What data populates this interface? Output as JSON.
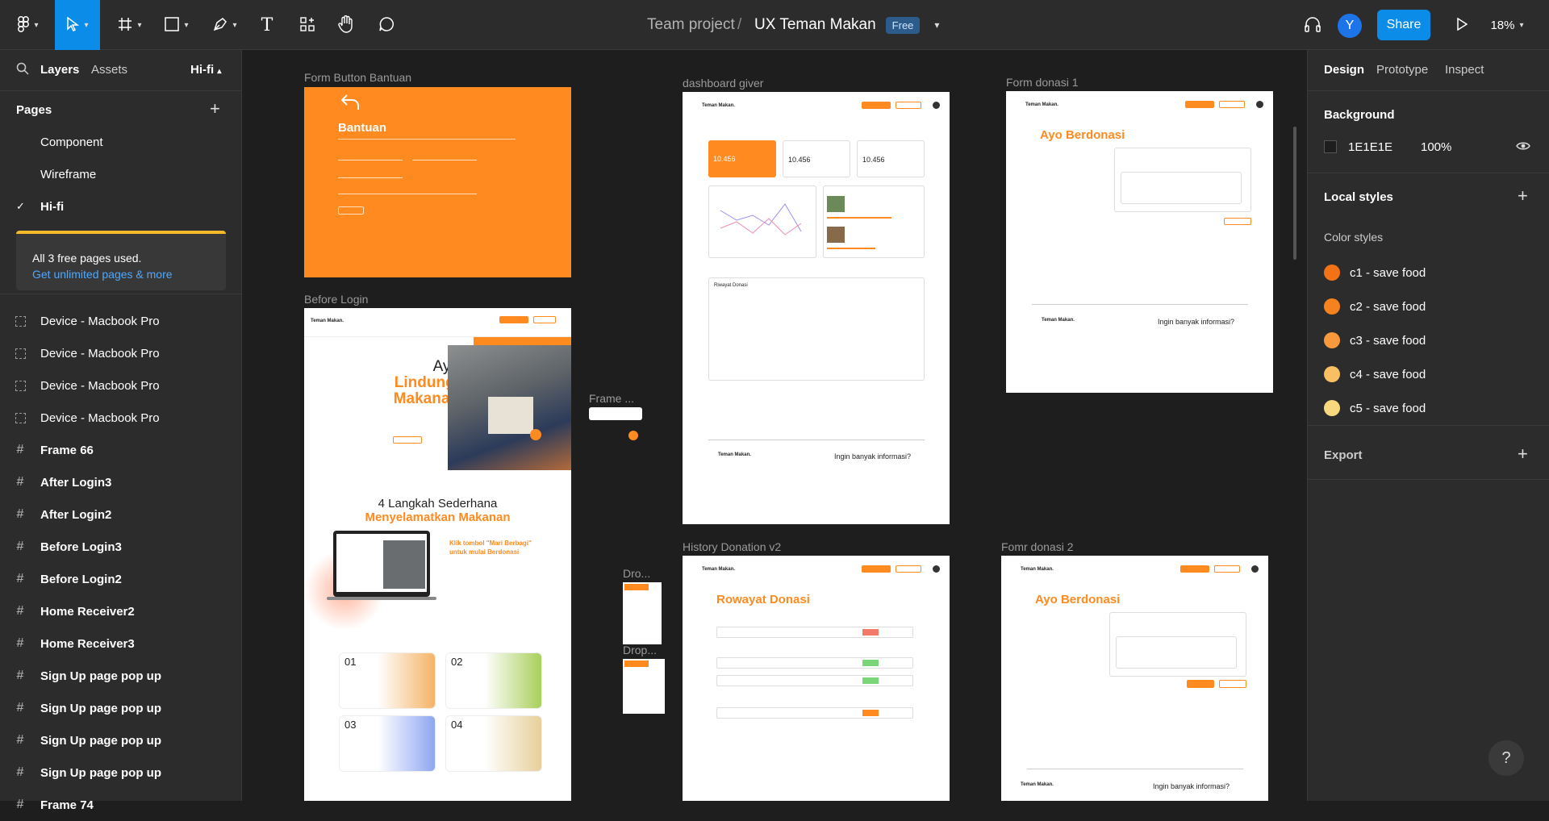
{
  "toolbar": {
    "breadcrumb_team": "Team project",
    "separator": "/",
    "file_name": "UX Teman Makan",
    "plan_badge": "Free",
    "avatar_initial": "Y",
    "share_label": "Share",
    "zoom": "18%"
  },
  "left_panel": {
    "tab_layers": "Layers",
    "tab_assets": "Assets",
    "page_selector": "Hi-fi",
    "pages_header": "Pages",
    "pages": [
      "Component",
      "Wireframe",
      "Hi-fi"
    ],
    "current_page_check": "✓",
    "notice_line1": "All 3 free pages used.",
    "notice_link": "Get unlimited pages & more",
    "layers": [
      {
        "label": "Device - Macbook Pro",
        "type": "device"
      },
      {
        "label": "Device - Macbook Pro",
        "type": "device"
      },
      {
        "label": "Device - Macbook Pro",
        "type": "device"
      },
      {
        "label": "Device - Macbook Pro",
        "type": "device"
      },
      {
        "label": "Frame 66",
        "type": "frame"
      },
      {
        "label": "After Login3",
        "type": "frame"
      },
      {
        "label": "After Login2",
        "type": "frame"
      },
      {
        "label": "Before Login3",
        "type": "frame"
      },
      {
        "label": "Before Login2",
        "type": "frame"
      },
      {
        "label": "Home Receiver2",
        "type": "frame"
      },
      {
        "label": "Home Receiver3",
        "type": "frame"
      },
      {
        "label": "Sign Up page pop up",
        "type": "frame"
      },
      {
        "label": "Sign Up page pop up",
        "type": "frame"
      },
      {
        "label": "Sign Up page pop up",
        "type": "frame"
      },
      {
        "label": "Sign Up page pop up",
        "type": "frame"
      },
      {
        "label": "Frame 74",
        "type": "frame"
      }
    ]
  },
  "canvas": {
    "frames": {
      "form_button_bantuan": {
        "label": "Form Button Bantuan",
        "title": "Bantuan"
      },
      "before_login": {
        "label": "Before Login",
        "brand": "Teman Makan.",
        "hero_line1": "Ayo",
        "hero_line2": "Lindungi",
        "hero_line3": "Makanan",
        "steps_title": "4 Langkah Sederhana",
        "steps_subtitle": "Menyelamatkan Makanan",
        "cta": "Klik tombol \"Mari Berbagi\" untuk mulai Berdonasi",
        "card_numbers": [
          "01",
          "02",
          "03",
          "04"
        ]
      },
      "dashboard_giver": {
        "label": "dashboard giver",
        "brand": "Teman Makan.",
        "stats": [
          "10.456",
          "10.456",
          "10.456"
        ],
        "riwayat": "Riwayat Donasi",
        "footer_brand": "Teman Makan.",
        "footer_title": "Ingin banyak informasi?"
      },
      "form_donasi_1": {
        "label": "Form donasi 1",
        "brand": "Teman Makan.",
        "title": "Ayo Berdonasi",
        "footer_brand": "Teman Makan.",
        "footer_title": "Ingin banyak informasi?"
      },
      "frame_small": {
        "label": "Frame ..."
      },
      "drop1": {
        "label": "Dro..."
      },
      "drop2": {
        "label": "Drop..."
      },
      "history_donation": {
        "label": "History Donation v2",
        "brand": "Teman Makan.",
        "title": "Rowayat Donasi"
      },
      "form_donasi_2": {
        "label": "Fomr donasi 2",
        "brand": "Teman Makan.",
        "title": "Ayo Berdonasi",
        "footer_brand": "Teman Makan.",
        "footer_title": "Ingin banyak informasi?"
      }
    }
  },
  "right_panel": {
    "tab_design": "Design",
    "tab_prototype": "Prototype",
    "tab_inspect": "Inspect",
    "background_header": "Background",
    "background_hex": "1E1E1E",
    "background_opacity": "100%",
    "local_styles_header": "Local styles",
    "color_styles_header": "Color styles",
    "color_styles": [
      {
        "name": "c1 - save food",
        "color": "#F47216"
      },
      {
        "name": "c2 - save food",
        "color": "#F6821F"
      },
      {
        "name": "c3 - save food",
        "color": "#F89A3C"
      },
      {
        "name": "c4 - save food",
        "color": "#F9C063"
      },
      {
        "name": "c5 - save food",
        "color": "#F9D97D"
      }
    ],
    "export_header": "Export"
  },
  "help": "?"
}
